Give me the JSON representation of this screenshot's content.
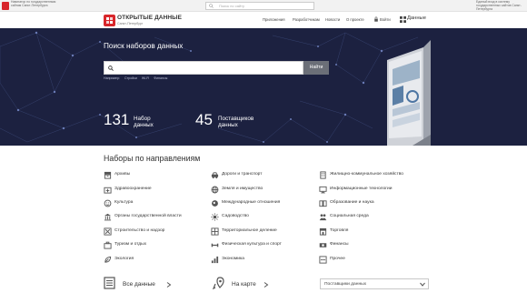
{
  "top_strip": {
    "left_text": "Навигатор по государственным сайтам Санкт-Петербурга",
    "search_placeholder": "Поиск по сайту",
    "right_text": "Единый вход в систему государственных сайтов Санкт-Петербурга"
  },
  "header": {
    "logo_title": "ОТКРЫТЫЕ ДАННЫЕ",
    "logo_subtitle": "Санкт-Петербург",
    "nav": [
      "Приложения",
      "Разработчикам",
      "Новости",
      "О проекте",
      "Войти"
    ],
    "data_link": "Данные"
  },
  "hero": {
    "title": "Поиск наборов данных",
    "search_value": "",
    "search_button": "Найти",
    "tags": [
      "Например:",
      "Стройки",
      "Wi-Fi",
      "Финансы"
    ],
    "stats": [
      {
        "number": "131",
        "label": "Набор данных"
      },
      {
        "number": "45",
        "label": "Поставщиков данных"
      }
    ]
  },
  "categories": {
    "title": "Наборы по направлениям",
    "columns": [
      [
        "Архивы",
        "Здравоохранение",
        "Культура",
        "Органы государственной власти",
        "Строительство и надзор",
        "Туризм и отдых",
        "Экология"
      ],
      [
        "Дороги и транспорт",
        "Земля и имущество",
        "Международные отношения",
        "Садоводство",
        "Территориальное деление",
        "Физическая культура и спорт",
        "Экономика"
      ],
      [
        "Жилищно-коммунальное хозяйство",
        "Информационные технологии",
        "Образование и наука",
        "Социальная среда",
        "Торговля",
        "Финансы",
        "Прочее"
      ]
    ]
  },
  "bottom": {
    "all_data": "Все данные",
    "on_map": "На карте",
    "select_value": "Поставщики данных"
  },
  "colors": {
    "brand_red": "#d8262b",
    "hero_bg": "#1c2140",
    "button_gray": "#6b6f78"
  }
}
